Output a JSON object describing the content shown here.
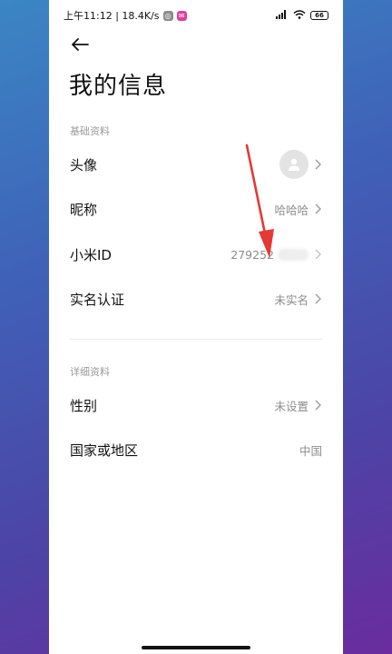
{
  "status_bar": {
    "time_speed": "上午11:12 | 18.4K/s",
    "badge_a": "◎",
    "badge_b": "✉",
    "battery": "66"
  },
  "page": {
    "title": "我的信息"
  },
  "sections": {
    "basic": "基础资料",
    "detail": "详细资料"
  },
  "rows": {
    "avatar": {
      "label": "头像"
    },
    "nickname": {
      "label": "昵称",
      "value": "哈哈哈"
    },
    "mi_id": {
      "label": "小米ID",
      "value": "279252"
    },
    "real_name": {
      "label": "实名认证",
      "value": "未实名"
    },
    "gender": {
      "label": "性别",
      "value": "未设置"
    },
    "region": {
      "label": "国家或地区",
      "value": "中国"
    }
  },
  "colors": {
    "annotation_arrow": "#e53935"
  }
}
